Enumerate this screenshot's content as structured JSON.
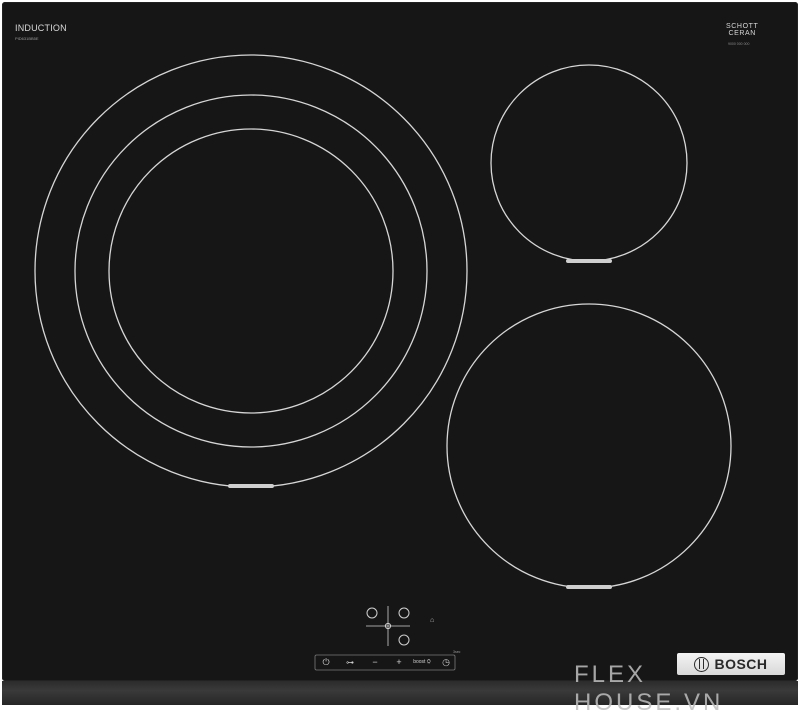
{
  "panel": {
    "top_left_label": "INDUCTION",
    "top_left_model": "PID631BB5E",
    "top_right_brand_line1": "SCHOTT",
    "top_right_brand_line2": "CERAN",
    "top_right_sub": "9000 000 000"
  },
  "controls": {
    "play_symbol": "⏻",
    "key_symbol": "⊶",
    "minus_symbol": "−",
    "plus_symbol": "+",
    "boost_label": "boost ⛭",
    "timer_symbol": "◷",
    "lock_label": "3sec",
    "side_symbol": "⌂"
  },
  "badge": {
    "brand": "BOSCH"
  },
  "watermark": "FLEX HOUSE.VN"
}
